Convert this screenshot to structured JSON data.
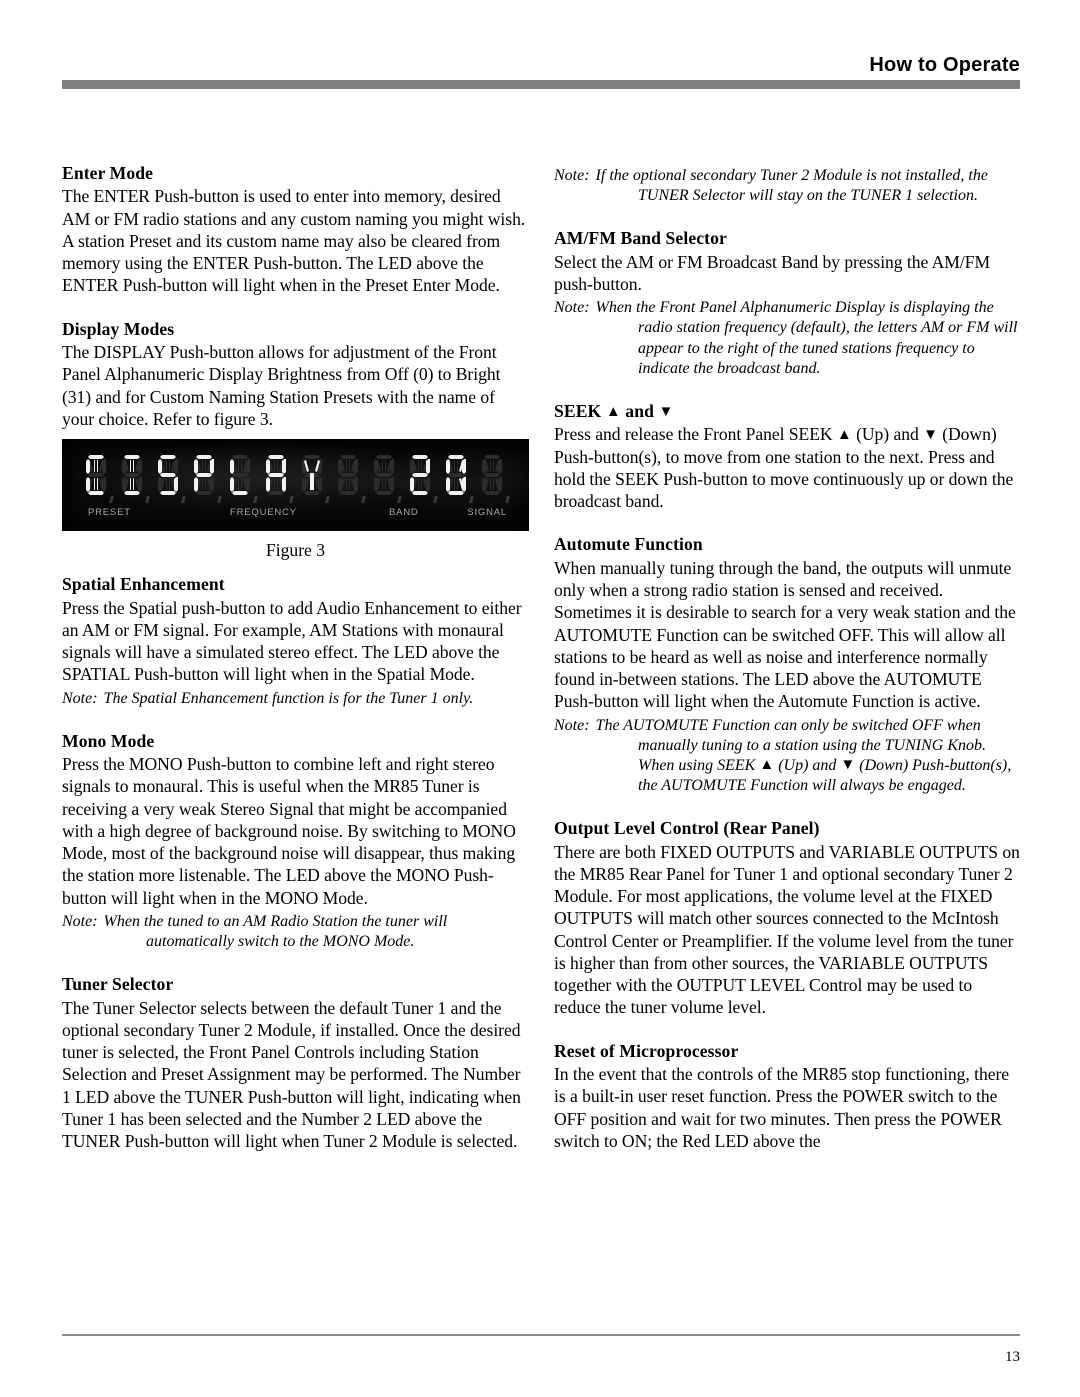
{
  "header": {
    "title": "How to Operate"
  },
  "left_column": {
    "enter_mode": {
      "heading": "Enter Mode",
      "body": "The ENTER Push-button is used to enter into memory, desired AM or FM radio stations and any custom naming you might wish. A station Preset and its custom name may also be cleared from memory using the ENTER Push-button. The LED above the ENTER Push-button will light when in the Preset Enter Mode."
    },
    "display_modes": {
      "heading": "Display Modes",
      "body": "The DISPLAY Push-button allows for adjustment of the Front Panel Alphanumeric Display Brightness from Off (0) to Bright (31) and for Custom Naming Station Presets with the name of your choice. Refer to figure 3."
    },
    "figure": {
      "caption": "Figure 3",
      "display_text": "DISPLAY",
      "display_value": "20",
      "segment_cells": [
        "D",
        "I",
        "S",
        "P",
        "L",
        "A",
        "Y",
        " ",
        " ",
        "2",
        "0",
        " "
      ],
      "labels": {
        "preset": "PRESET",
        "frequency": "FREQUENCY",
        "band": "BAND",
        "signal": "SIGNAL"
      }
    },
    "spatial_enhancement": {
      "heading": "Spatial Enhancement",
      "body": "Press the Spatial push-button to add Audio Enhancement to either an AM or FM signal. For example, AM Stations with monaural signals will have a simulated stereo effect. The LED above the SPATIAL Push-button will light when in the Spatial Mode.",
      "note_label": "Note:",
      "note": "The Spatial Enhancement function is for the Tuner 1 only."
    },
    "mono_mode": {
      "heading": "Mono Mode",
      "body": "Press the MONO Push-button to combine left and right stereo signals to monaural. This is useful when the MR85 Tuner is receiving a very weak Stereo Signal that might be accompanied with a high degree of background noise. By switching to MONO Mode, most of the background noise will disappear, thus making the station more listenable. The LED above the MONO Push-button will light when in the MONO Mode.",
      "note_label": "Note:",
      "note": "When the tuned to an AM Radio Station the tuner will automatically switch to the MONO Mode."
    },
    "tuner_selector": {
      "heading": "Tuner Selector",
      "body": "The Tuner Selector selects between the default Tuner 1 and the optional secondary Tuner 2 Module, if installed. Once the desired tuner is selected, the Front Panel Controls including Station Selection and Preset Assignment may be performed. The Number 1 LED above the TUNER Push-button will light, indicating when Tuner 1 has been selected and the Number 2 LED above the TUNER Push-button will light when Tuner 2 Module is selected."
    }
  },
  "right_column": {
    "tuner_note": {
      "note_label": "Note:",
      "note": "If the optional secondary Tuner 2 Module is not installed, the TUNER Selector will stay on the TUNER 1 selection."
    },
    "am_fm_band_selector": {
      "heading": "AM/FM Band Selector",
      "body": "Select the AM or FM Broadcast Band by pressing the AM/FM push-button.",
      "note_label": "Note:",
      "note": "When the Front Panel Alphanumeric Display is displaying the radio station frequency (default), the letters AM or FM will appear to the right of the tuned stations frequency to indicate the broadcast band."
    },
    "seek": {
      "heading_prefix": "SEEK",
      "heading_up_icon": "▲",
      "heading_conj": "and",
      "heading_down_icon": "▼",
      "body_part1": "Press and release the Front Panel SEEK",
      "body_up_icon": "▲",
      "body_part2": "(Up) and",
      "body_down_icon": "▼",
      "body_part3": "(Down) Push-button(s), to move from one station to the next. Press and hold the SEEK Push-button to move continuously up or down the broadcast band."
    },
    "automute": {
      "heading": "Automute Function",
      "body": "When manually tuning through the band, the outputs will unmute only when a strong radio station is sensed and received. Sometimes it is desirable to search for a very weak station and the AUTOMUTE Function can be switched OFF. This will allow all stations to be heard as well as noise and interference normally found in-between stations. The LED above the AUTOMUTE Push-button will light when the Automute Function is active.",
      "note_label": "Note:",
      "note_part1": "The AUTOMUTE Function can only be switched OFF when manually tuning to a station using the TUNING Knob. When using SEEK",
      "note_up_icon": "▲",
      "note_part2": "(Up) and",
      "note_down_icon": "▼",
      "note_part3": "(Down) Push-button(s), the AUTOMUTE Function will always be engaged."
    },
    "output_level_control": {
      "heading": "Output Level Control (Rear Panel)",
      "body": "There are both FIXED OUTPUTS and VARIABLE OUTPUTS on the MR85 Rear Panel for Tuner 1 and optional secondary Tuner 2 Module. For most applications, the volume level at the FIXED OUTPUTS will match other sources connected to the McIntosh Control Center or Preamplifier. If the volume level from the tuner is higher than from other sources, the VARIABLE OUTPUTS together with the OUTPUT LEVEL Control may be used to reduce the tuner volume level."
    },
    "reset_of_microprocessor": {
      "heading": "Reset of Microprocessor",
      "body": "In the event that the controls of the MR85 stop functioning, there is a built-in user reset function. Press the POWER switch to the OFF position and wait for two minutes. Then press the POWER switch to ON; the Red LED above the"
    }
  },
  "footer": {
    "page_number": "13"
  },
  "colors": {
    "header_rule": "#7f7f7f",
    "footer_rule": "#8a8a8a",
    "display_background": "#090909",
    "segment_on": "#f2f2f2",
    "segment_off": "#2c2c2c",
    "display_label": "#a8a8a8"
  }
}
